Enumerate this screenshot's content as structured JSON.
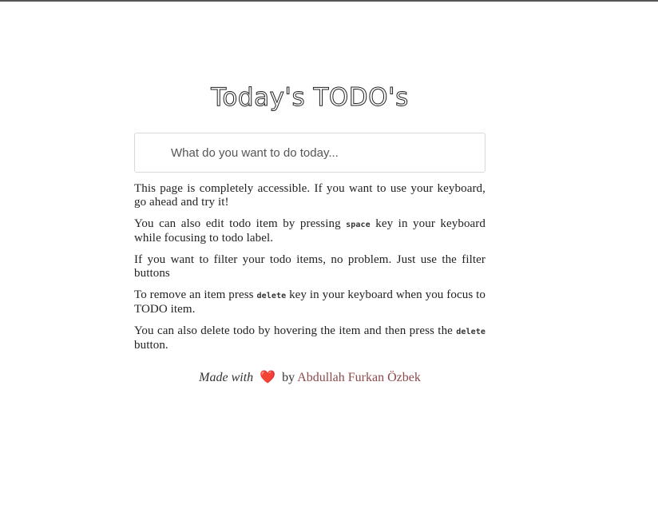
{
  "header": {
    "title": "Today's TODO's"
  },
  "input": {
    "placeholder": "What do you want to do today..."
  },
  "help": {
    "p1": "This page is completely accessible. If you want to use your keyboard, go ahead and try it!",
    "p2_before": "You can also edit todo item by pressing ",
    "p2_key": "space",
    "p2_after": " key in your keyboard while focusing to todo label.",
    "p3": "If you want to filter your todo items, no problem. Just use the filter buttons",
    "p4_before": "To remove an item press ",
    "p4_key": "delete",
    "p4_after": " key in your keyboard when you focus to TODO item.",
    "p5_before": "You can also delete todo by hovering the item and then press the ",
    "p5_key": "delete",
    "p5_after": " button."
  },
  "footer": {
    "made_with": "Made with",
    "heart": "❤️",
    "by": "by",
    "author": "Abdullah Furkan Özbek"
  },
  "colors": {
    "heart": "#e53935",
    "author_link": "#8c4a4a"
  }
}
